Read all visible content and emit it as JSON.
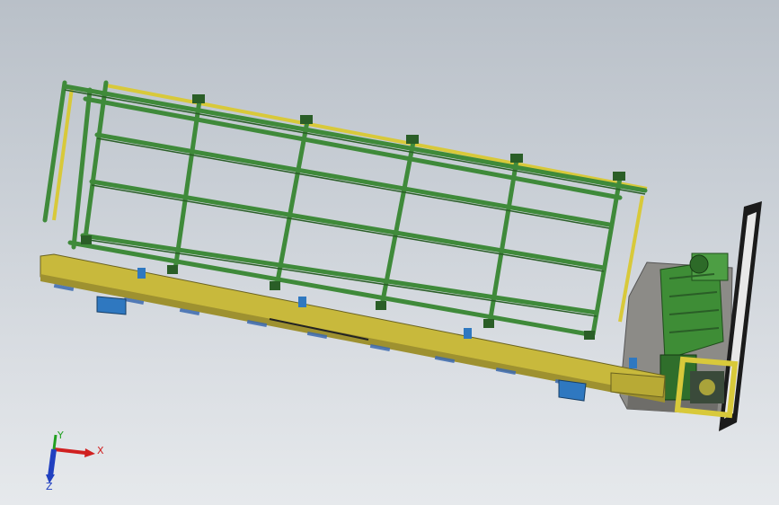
{
  "viewport": {
    "background_top": "#b9c0c8",
    "background_bottom": "#e6e9ec"
  },
  "model": {
    "frame_color": "#3f8a3a",
    "frame_dark": "#2a5e27",
    "rail_color": "#d8c93a",
    "base_color": "#c8b93c",
    "motor_color": "#3d8b35",
    "housing_color": "#8a8a86",
    "block_color": "#2f78c0"
  },
  "triad": {
    "x_label": "X",
    "y_label": "Y",
    "z_label": "Z",
    "x_color": "#d02020",
    "y_color": "#20a020",
    "z_color": "#2040c0"
  }
}
